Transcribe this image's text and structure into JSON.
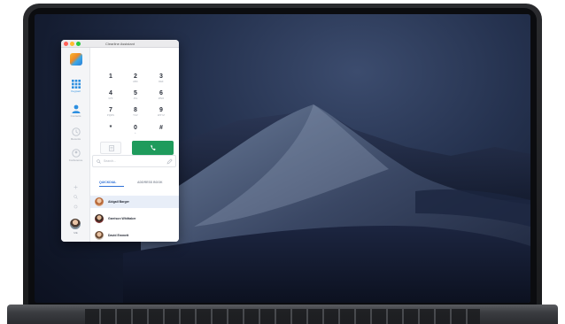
{
  "window": {
    "title": "Clearline Assistant"
  },
  "sidebar": {
    "items": [
      {
        "label": "Keypad",
        "icon": "keypad-icon",
        "active": true
      },
      {
        "label": "Contacts",
        "icon": "contacts-icon",
        "active": false
      },
      {
        "label": "Recents",
        "icon": "recents-icon",
        "active": false
      },
      {
        "label": "Conference",
        "icon": "conference-icon",
        "active": false
      }
    ],
    "user_label": "ME"
  },
  "keypad": {
    "keys": [
      {
        "digit": "1",
        "letters": ""
      },
      {
        "digit": "2",
        "letters": "ABC"
      },
      {
        "digit": "3",
        "letters": "DEF"
      },
      {
        "digit": "4",
        "letters": "GHI"
      },
      {
        "digit": "5",
        "letters": "JKL"
      },
      {
        "digit": "6",
        "letters": "MNO"
      },
      {
        "digit": "7",
        "letters": "PQRS"
      },
      {
        "digit": "8",
        "letters": "TUV"
      },
      {
        "digit": "9",
        "letters": "WXYZ"
      },
      {
        "digit": "*",
        "letters": ""
      },
      {
        "digit": "0",
        "letters": "+"
      },
      {
        "digit": "#",
        "letters": ""
      }
    ]
  },
  "search": {
    "placeholder": "Search..."
  },
  "tabs": {
    "quickdial": "QUICKDIAL",
    "address_book": "ADDRESS BOOK"
  },
  "contacts": [
    {
      "name": "Abigail Barger",
      "highlighted": true
    },
    {
      "name": "Garrison Whittaker",
      "highlighted": false
    },
    {
      "name": "David Emmett",
      "highlighted": false
    }
  ],
  "colors": {
    "accent": "#2d6fd6",
    "call_green": "#1f9b5c"
  }
}
